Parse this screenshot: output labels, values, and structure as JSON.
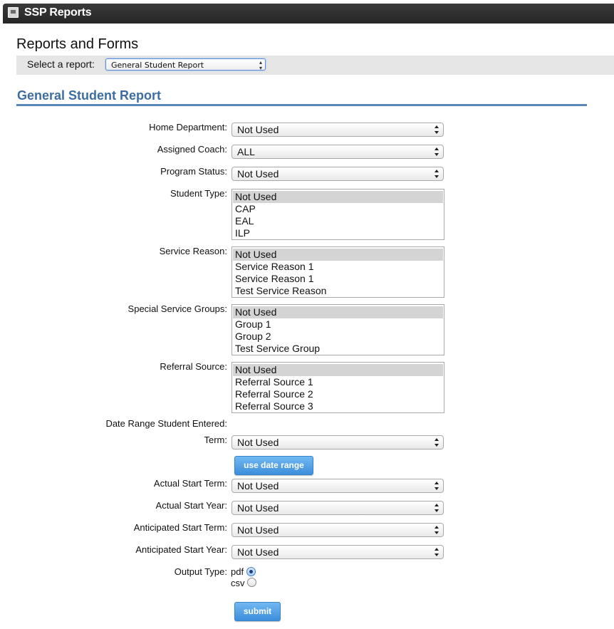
{
  "window": {
    "title": "SSP Reports"
  },
  "page": {
    "heading": "Reports and Forms",
    "select_label": "Select a report:",
    "selected_report": "General Student Report",
    "section_title": "General Student Report"
  },
  "form": {
    "home_department": {
      "label": "Home Department:",
      "value": "Not Used"
    },
    "assigned_coach": {
      "label": "Assigned Coach:",
      "value": "ALL"
    },
    "program_status": {
      "label": "Program Status:",
      "value": "Not Used"
    },
    "student_type": {
      "label": "Student Type:",
      "options": [
        "Not Used",
        "CAP",
        "EAL",
        "ILP"
      ],
      "selected": "Not Used"
    },
    "service_reason": {
      "label": "Service Reason:",
      "options": [
        "Not Used",
        "Service Reason 1",
        "Service Reason 1",
        "Test Service Reason"
      ],
      "selected": "Not Used"
    },
    "special_service_groups": {
      "label": "Special Service Groups:",
      "options": [
        "Not Used",
        "Group 1",
        "Group 2",
        "Test Service Group"
      ],
      "selected": "Not Used"
    },
    "referral_source": {
      "label": "Referral Source:",
      "options": [
        "Not Used",
        "Referral Source 1",
        "Referral Source 2",
        "Referral Source 3"
      ],
      "selected": "Not Used"
    },
    "date_range_label": "Date Range Student Entered:",
    "term": {
      "label": "Term:",
      "value": "Not Used"
    },
    "use_date_range_button": "use date range",
    "actual_start_term": {
      "label": "Actual Start Term:",
      "value": "Not Used"
    },
    "actual_start_year": {
      "label": "Actual Start Year:",
      "value": "Not Used"
    },
    "anticipated_start_term": {
      "label": "Anticipated Start Term:",
      "value": "Not Used"
    },
    "anticipated_start_year": {
      "label": "Anticipated Start Year:",
      "value": "Not Used"
    },
    "output_type": {
      "label": "Output Type:",
      "options": [
        "pdf",
        "csv"
      ],
      "selected": "pdf"
    },
    "submit_button": "submit"
  },
  "colors": {
    "title_bar": "#2e2e2e",
    "accent": "#3d6da1",
    "button": "#4a9be4"
  }
}
